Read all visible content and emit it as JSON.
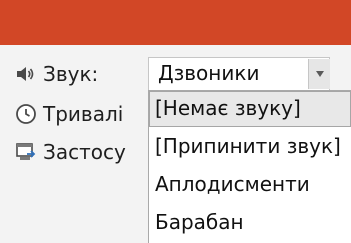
{
  "ribbon": {
    "accent_color": "#d24726"
  },
  "options": {
    "sound": {
      "label": "Звук:",
      "icon": "speaker-icon"
    },
    "duration": {
      "label": "Тривалі",
      "icon": "clock-icon"
    },
    "apply": {
      "label": "Застосу",
      "icon": "apply-all-icon"
    }
  },
  "sound_select": {
    "value": "Дзвоники",
    "options": [
      "[Немає звуку]",
      "[Припинити звук]",
      "Аплодисменти",
      "Барабан"
    ],
    "highlighted_index": 0
  }
}
